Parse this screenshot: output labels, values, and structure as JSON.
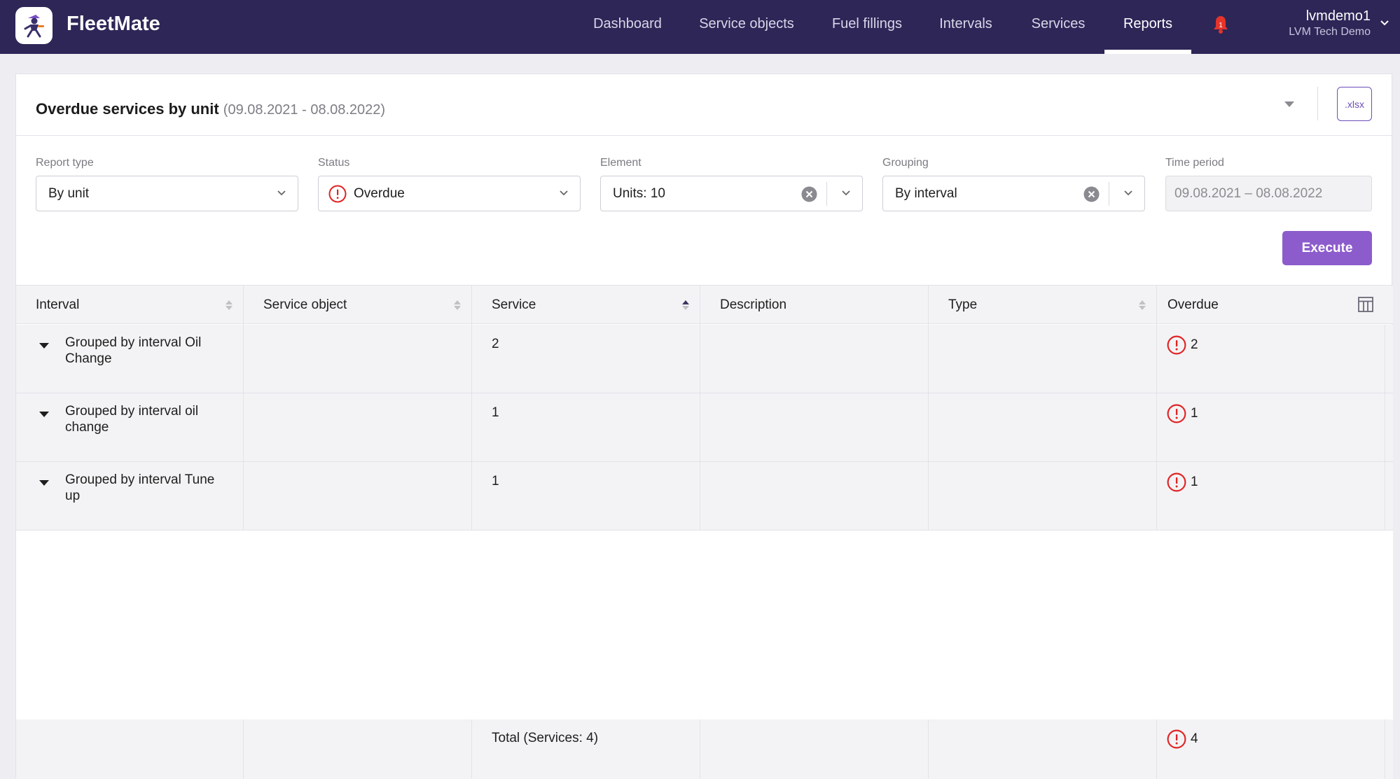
{
  "app": {
    "brand": "FleetMate"
  },
  "nav": {
    "items": [
      "Dashboard",
      "Service objects",
      "Fuel fillings",
      "Intervals",
      "Services",
      "Reports"
    ],
    "active": "Reports",
    "notification_count": "1"
  },
  "user": {
    "name": "lvmdemo1",
    "company": "LVM Tech Demo"
  },
  "report": {
    "title": "Overdue services by unit",
    "range": "(09.08.2021 - 08.08.2022)",
    "export_label": ".xlsx"
  },
  "filters": {
    "report_type": {
      "label": "Report type",
      "value": "By unit"
    },
    "status": {
      "label": "Status",
      "value": "Overdue"
    },
    "element": {
      "label": "Element",
      "value": "Units: 10"
    },
    "grouping": {
      "label": "Grouping",
      "value": "By interval"
    },
    "time_period": {
      "label": "Time period",
      "value": "09.08.2021 – 08.08.2022"
    },
    "execute_label": "Execute"
  },
  "table": {
    "columns": [
      "Interval",
      "Service object",
      "Service",
      "Description",
      "Type",
      "Overdue"
    ],
    "rows": [
      {
        "label": "Grouped by interval Oil Change",
        "service": "2",
        "overdue": "2"
      },
      {
        "label": "Grouped by interval oil change",
        "service": "1",
        "overdue": "1"
      },
      {
        "label": "Grouped by interval Tune up",
        "service": "1",
        "overdue": "1"
      }
    ],
    "total": {
      "label": "Total (Services: 4)",
      "overdue": "4"
    }
  },
  "colors": {
    "navbar": "#2d2657",
    "accent": "#8c5ccc",
    "alert": "#e02424"
  }
}
